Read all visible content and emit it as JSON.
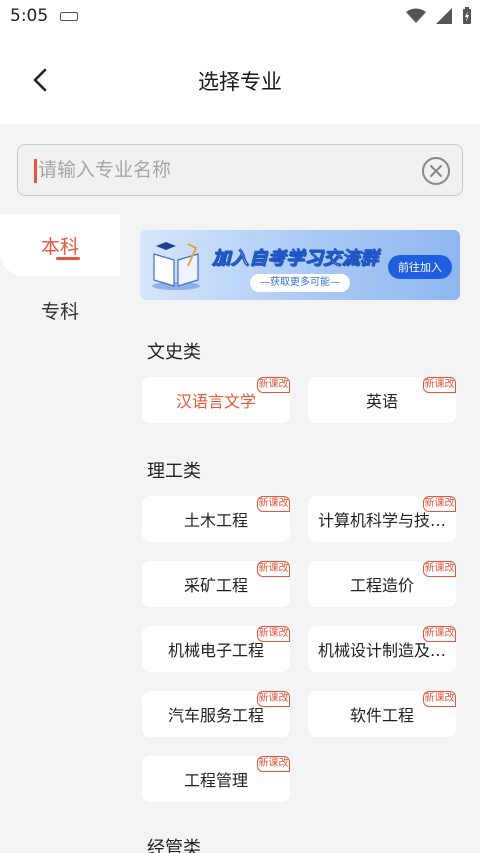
{
  "status": {
    "time": "5:05"
  },
  "header": {
    "title": "选择专业"
  },
  "search": {
    "placeholder": "请输入专业名称",
    "value": ""
  },
  "tabs": [
    {
      "label": "本科",
      "active": true
    },
    {
      "label": "专科",
      "active": false
    }
  ],
  "banner": {
    "title": "加入自考学习交流群",
    "subtitle": "—获取更多可能—",
    "button": "前往加入"
  },
  "badge_text": "新课改",
  "sections": [
    {
      "title": "文史类",
      "items": [
        {
          "label": "汉语言文学",
          "selected": true,
          "badge": true
        },
        {
          "label": "英语",
          "selected": false,
          "badge": true
        }
      ]
    },
    {
      "title": "理工类",
      "items": [
        {
          "label": "土木工程",
          "badge": true
        },
        {
          "label": "计算机科学与技…",
          "badge": true
        },
        {
          "label": "采矿工程",
          "badge": true
        },
        {
          "label": "工程造价",
          "badge": true
        },
        {
          "label": "机械电子工程",
          "badge": true
        },
        {
          "label": "机械设计制造及…",
          "badge": true
        },
        {
          "label": "汽车服务工程",
          "badge": true
        },
        {
          "label": "软件工程",
          "badge": true
        },
        {
          "label": "工程管理",
          "badge": true
        }
      ]
    },
    {
      "title": "经管类",
      "items": []
    }
  ],
  "colors": {
    "accent": "#e8553a",
    "banner_blue": "#1e5fe0"
  }
}
